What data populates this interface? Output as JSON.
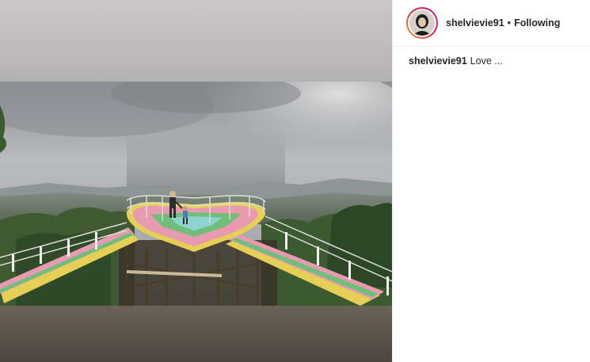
{
  "post": {
    "image_alt": "Couple on a colorful heart-shaped wooden viewing deck above a forested valley under stormy clouds"
  },
  "header": {
    "username": "shelvievie91",
    "separator": "•",
    "follow_status": "Following"
  },
  "caption": {
    "username": "shelvievie91",
    "text": "Love ..."
  },
  "colors": {
    "border": "#efefef",
    "text": "#262626",
    "deck_pink": "#e79ab0",
    "deck_green": "#6fbf7a",
    "deck_yellow": "#e6cf55"
  },
  "icons": {
    "avatar": "profile-avatar"
  }
}
